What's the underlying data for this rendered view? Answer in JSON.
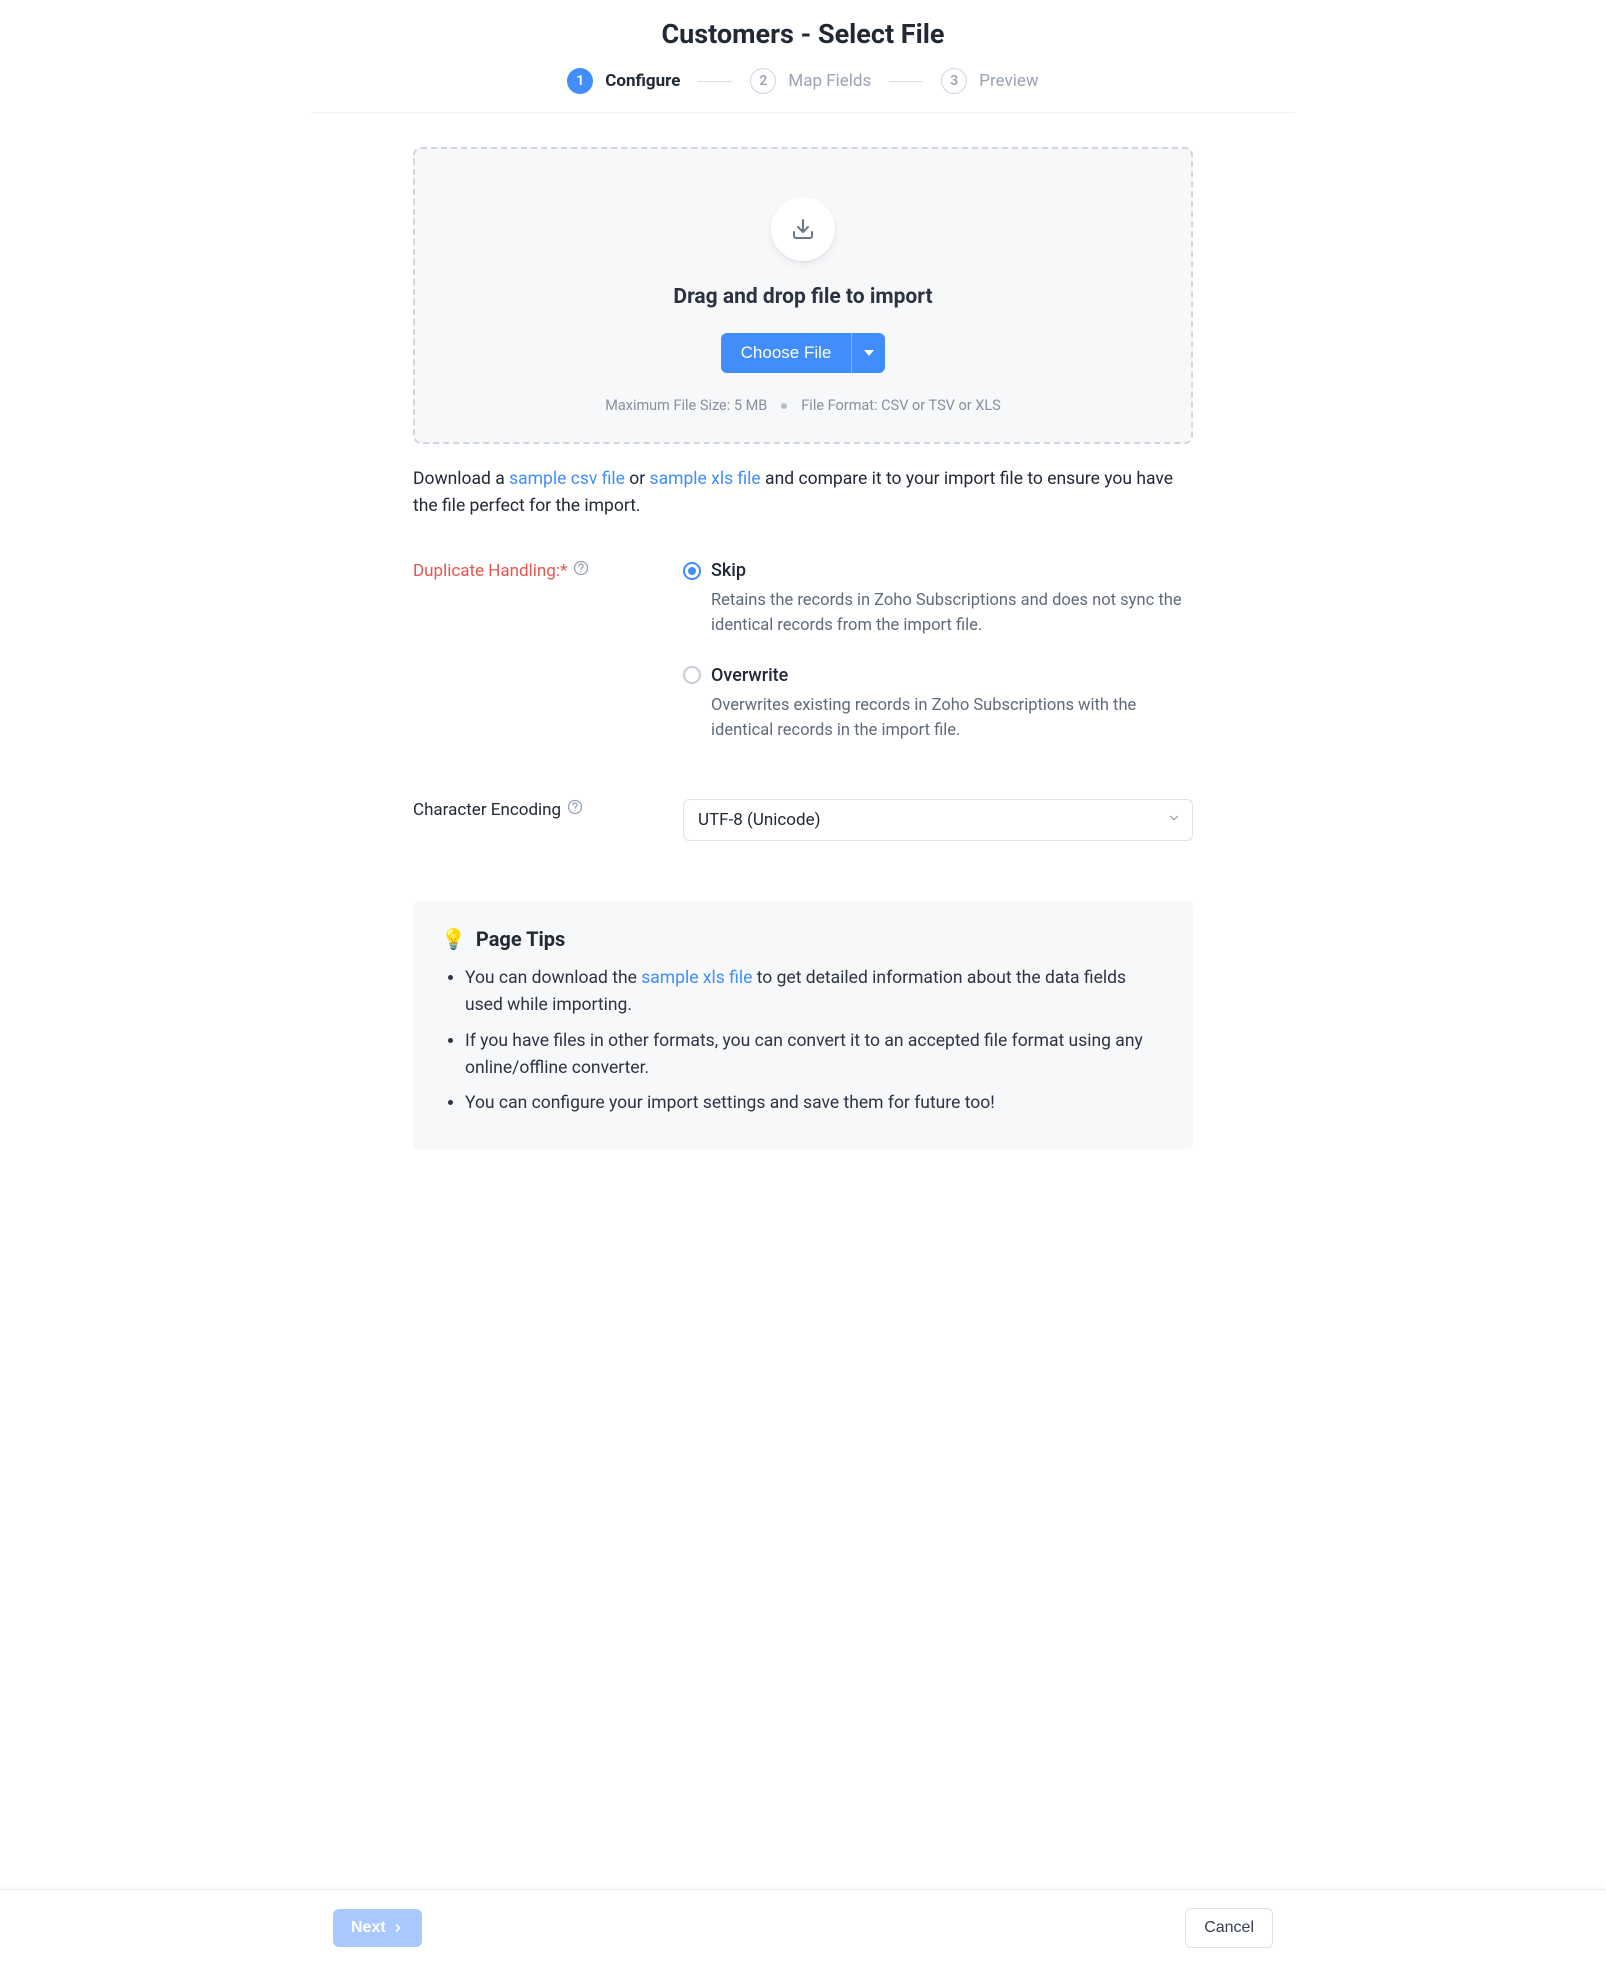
{
  "title": "Customers - Select File",
  "steps": [
    {
      "num": "1",
      "label": "Configure"
    },
    {
      "num": "2",
      "label": "Map Fields"
    },
    {
      "num": "3",
      "label": "Preview"
    }
  ],
  "dropzone": {
    "heading": "Drag and drop file to import",
    "button": "Choose File",
    "maxsize": "Maximum File Size: 5 MB",
    "format": "File Format: CSV or TSV or XLS"
  },
  "download": {
    "prefix": "Download a ",
    "csv": "sample csv file",
    "mid": " or ",
    "xls": "sample xls file",
    "suffix": " and compare it to your import file to ensure you have the file perfect for the import."
  },
  "duplicate": {
    "label": "Duplicate Handling:*",
    "options": [
      {
        "title": "Skip",
        "desc": "Retains the records in Zoho Subscriptions and does not sync the identical records from the import file.",
        "selected": true
      },
      {
        "title": "Overwrite",
        "desc": "Overwrites existing records in Zoho Subscriptions with the identical records in the import file.",
        "selected": false
      }
    ]
  },
  "encoding": {
    "label": "Character Encoding",
    "value": "UTF-8 (Unicode)"
  },
  "tips": {
    "heading": "Page Tips",
    "bulb": "💡",
    "items": [
      {
        "pre": "You can download the ",
        "link": "sample xls file",
        "post": " to get detailed information about the data fields used while importing."
      },
      {
        "pre": "If you have files in other formats, you can convert it to an accepted file format using any online/offline converter.",
        "link": "",
        "post": ""
      },
      {
        "pre": "You can configure your import settings and save them for future too!",
        "link": "",
        "post": ""
      }
    ]
  },
  "footer": {
    "next": "Next",
    "cancel": "Cancel"
  }
}
